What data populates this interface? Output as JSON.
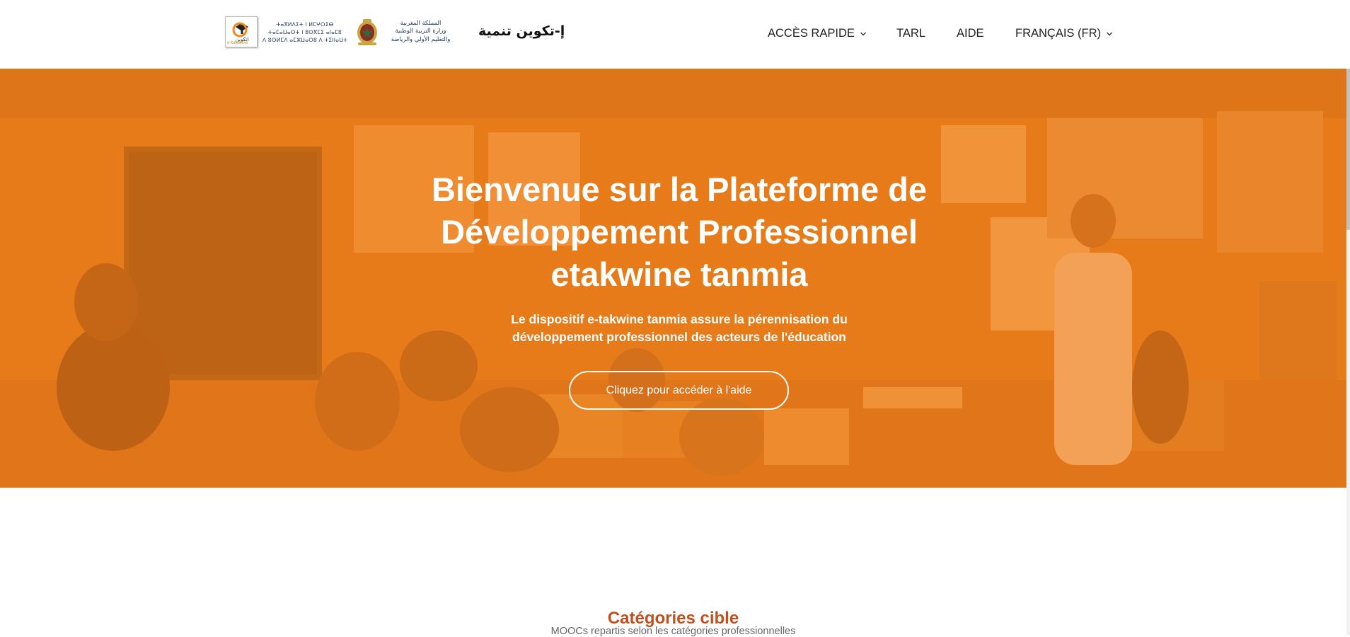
{
  "header": {
    "logo_text": "e-takwine",
    "tifinagh_lines": [
      "ⵜⴰⴳⵍⴷⵉⵜ ⵏ ⵍⵎⵖⵔⵉⴱ",
      "ⵜⴰⵎⴰⵡⴰⵙⵜ ⵏ ⵓⵙⴳⵎⵉ ⴰⵏⴰⵎⵓ",
      "ⴷ ⵓⵙⵍⵎⴷ ⴰⵎⵣⵡⴰⵔⵓ ⴷ ⵜⵉⵏⵏⴰⵡⵜ"
    ],
    "arabic_lines": [
      "المملكة المغربية",
      "وزارة التربية الوطنية",
      "والتعليم الأولي والرياضة"
    ],
    "site_name": "إ-تكوين تنمية"
  },
  "nav": {
    "acces_rapide": "ACCÈS RAPIDE",
    "tarl": "TARL",
    "aide": "AIDE",
    "language": "FRANÇAIS (FR)"
  },
  "hero": {
    "title": "Bienvenue sur la Plateforme de Développement Professionnel etakwine tanmia",
    "subtitle": "Le dispositif e-takwine tanmia assure la pérennisation du développement professionnel des acteurs de l'éducation",
    "button_label": "Cliquez pour accéder à l'aide",
    "overlay_color": "#f38219"
  },
  "section": {
    "title": "Catégories cible",
    "subtitle": "MOOCs repartis selon les catégories professionnelles"
  },
  "icons": {
    "chevron": "chevron-down-icon",
    "logo": "etakwine-logo-icon",
    "emblem": "royal-emblem-icon"
  },
  "colors": {
    "section_title": "#c0501f",
    "hero_orange": "#e8821e"
  }
}
